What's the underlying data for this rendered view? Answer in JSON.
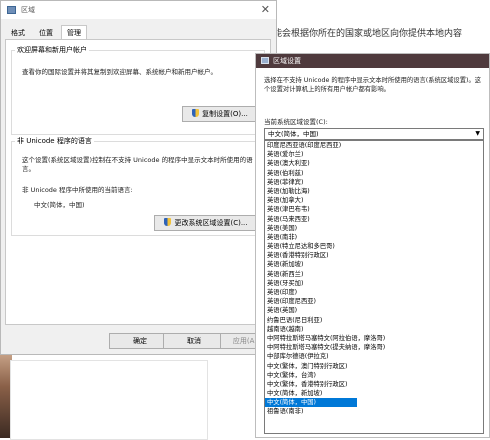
{
  "background": {
    "text": "用可能会根据你所在的国家或地区向你提供本地内容"
  },
  "region_dialog": {
    "title": "区域",
    "tabs": [
      "格式",
      "位置",
      "管理"
    ],
    "active_tab": "管理",
    "welcome_group": {
      "title": "欢迎屏幕和新用户帐户",
      "text": "查看你的国际设置并将其复制到欢迎屏幕、系统帐户和新用户帐户。",
      "copy_button": "复制设置(O)..."
    },
    "unicode_group": {
      "title": "非 Unicode 程序的语言",
      "text": "这个设置(系统区域设置)控制在不支持 Unicode 的程序中显示文本时所使用的语言。",
      "current_label": "非 Unicode 程序中所使用的当前语言:",
      "current_value": "中文(简体，中国)",
      "change_button": "更改系统区域设置(C)..."
    },
    "ok_button": "确定",
    "cancel_button": "取消",
    "apply_button": "应用(A)"
  },
  "locale_dialog": {
    "title": "区域设置",
    "description": "选择在不支持 Unicode 的程序中显示文本时所使用的语言(系统区域设置)。这个设置对计算机上的所有用户帐户都有影响。",
    "current_label": "当前系统区域设置(C):",
    "selected": "中文(简体，中国)",
    "options": [
      "印度尼西亚语(印度尼西亚)",
      "英语(爱尔兰)",
      "英语(澳大利亚)",
      "英语(伯利兹)",
      "英语(菲律宾)",
      "英语(加勒比海)",
      "英语(加拿大)",
      "英语(津巴布韦)",
      "英语(马来西亚)",
      "英语(美国)",
      "英语(南非)",
      "英语(特立尼达和多巴哥)",
      "英语(香港特别行政区)",
      "英语(新加坡)",
      "英语(新西兰)",
      "英语(牙买加)",
      "英语(印度)",
      "英语(印度尼西亚)",
      "英语(英国)",
      "约鲁巴语(尼日利亚)",
      "越南语(越南)",
      "中阿特拉斯塔马塞特文(阿拉伯语，摩洛哥)",
      "中阿特拉斯塔马塞特文(提夫纳语，摩洛哥)",
      "中部库尔德语(伊拉克)",
      "中文(繁体，澳门特别行政区)",
      "中文(繁体，台湾)",
      "中文(繁体，香港特别行政区)",
      "中文(简体，新加坡)",
      "中文(简体，中国)",
      "祖鲁语(南非)"
    ]
  }
}
